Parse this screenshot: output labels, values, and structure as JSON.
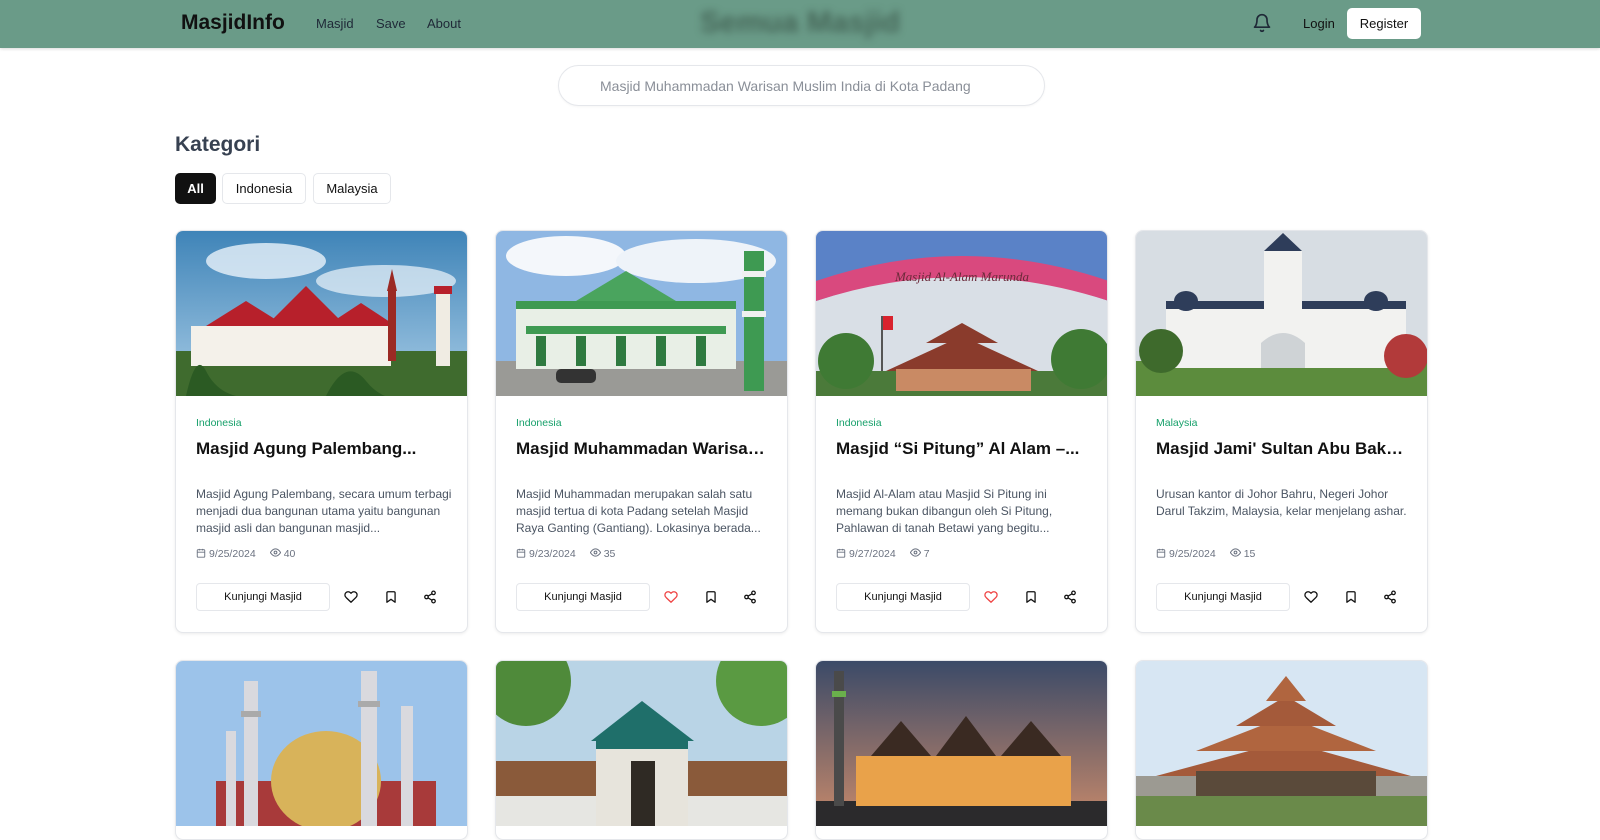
{
  "nav": {
    "brand": "MasjidInfo",
    "links": [
      "Masjid",
      "Save",
      "About"
    ],
    "center_title": "Semua Masjid",
    "login": "Login",
    "register": "Register"
  },
  "search": {
    "placeholder": "Masjid Muhammadan Warisan Muslim India di Kota Padang"
  },
  "kategori": {
    "title": "Kategori",
    "chips": [
      "All",
      "Indonesia",
      "Malaysia"
    ],
    "active": "All"
  },
  "cards": [
    {
      "category": "Indonesia",
      "title": "Masjid Agung Palembang...",
      "desc": "Masjid Agung Palembang, secara umum terbagi menjadi dua bangunan utama yaitu bangunan masjid asli dan bangunan masjid...",
      "date": "9/25/2024",
      "views": "40",
      "visit": "Kunjungi Masjid",
      "liked": false,
      "image": "mosque-white-red-roofs"
    },
    {
      "category": "Indonesia",
      "title": "Masjid Muhammadan Warisan...",
      "desc": "Masjid Muhammadan merupakan salah satu masjid tertua di kota Padang setelah Masjid Raya Ganting (Gantiang). Lokasinya berada...",
      "date": "9/23/2024",
      "views": "35",
      "visit": "Kunjungi Masjid",
      "liked": true,
      "image": "mosque-green-facade"
    },
    {
      "category": "Indonesia",
      "title": "Masjid “Si Pitung” Al Alam –...",
      "desc": "Masjid Al-Alam atau Masjid Si Pitung ini memang bukan dibangun oleh Si Pitung, Pahlawan di tanah Betawi yang begitu...",
      "date": "9/27/2024",
      "views": "7",
      "visit": "Kunjungi Masjid",
      "liked": true,
      "image": "mosque-arch-sign"
    },
    {
      "category": "Malaysia",
      "title": "Masjid Jami' Sultan Abu Bakar...",
      "desc": "Urusan kantor di Johor Bahru, Negeri Johor Darul Takzim, Malaysia, kelar menjelang ashar.",
      "date": "9/25/2024",
      "views": "15",
      "visit": "Kunjungi Masjid",
      "liked": false,
      "image": "mosque-white-tower"
    }
  ],
  "partial_cards": [
    {
      "image": "mosque-golden-dome"
    },
    {
      "image": "mosque-gate-green"
    },
    {
      "image": "mosque-evening-lights"
    },
    {
      "image": "mosque-tiered-roof"
    }
  ],
  "colors": {
    "navbar": "#6a9b88",
    "category": "#16a06a",
    "liked": "#ef4444",
    "chip_active": "#111111"
  }
}
